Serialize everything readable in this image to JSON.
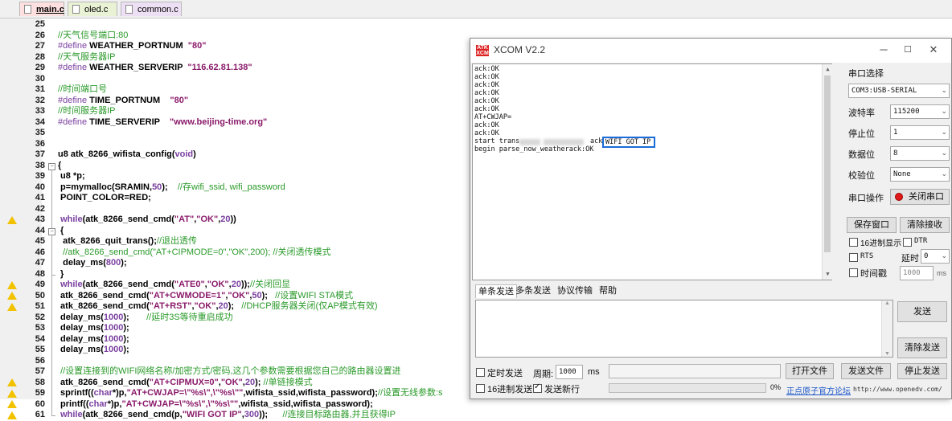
{
  "editor": {
    "tabs": [
      "main.c",
      "oled.c",
      "common.c"
    ],
    "lines": [
      {
        "n": "25",
        "html": ""
      },
      {
        "n": "26",
        "html": "<span class=\"cm\">//天气信号端口:80</span>"
      },
      {
        "n": "27",
        "html": "<span class=\"pp\">#define</span> WEATHER_PORTNUM  <span class=\"str\">\"80\"</span>"
      },
      {
        "n": "28",
        "html": "<span class=\"cm\">//天气服务器IP</span>"
      },
      {
        "n": "29",
        "html": "<span class=\"pp\">#define</span> WEATHER_SERVERIP  <span class=\"str\">\"116.62.81.138\"</span>"
      },
      {
        "n": "30",
        "html": ""
      },
      {
        "n": "31",
        "html": "<span class=\"cm\">//时间端口号</span>"
      },
      {
        "n": "32",
        "html": "<span class=\"pp\">#define</span> TIME_PORTNUM    <span class=\"str\">\"80\"</span>"
      },
      {
        "n": "33",
        "html": "<span class=\"cm\">//时间服务器IP</span>"
      },
      {
        "n": "34",
        "html": "<span class=\"pp\">#define</span> TIME_SERVERIP    <span class=\"str\">\"www.beijing-time.org\"</span>"
      },
      {
        "n": "35",
        "html": ""
      },
      {
        "n": "36",
        "html": ""
      },
      {
        "n": "37",
        "html": "u8 atk_8266_wifista_config(<span class=\"kw\">void</span>)"
      },
      {
        "n": "38",
        "html": "{"
      },
      {
        "n": "39",
        "html": " u8 *p;"
      },
      {
        "n": "40",
        "html": " p=mymalloc(SRAMIN,<span class=\"num\">50</span>);    <span class=\"cm\">//存wifi_ssid, wifi_password</span>"
      },
      {
        "n": "41",
        "html": " POINT_COLOR=RED;"
      },
      {
        "n": "42",
        "html": ""
      },
      {
        "n": "43",
        "html": " <span class=\"kw\">while</span>(atk_8266_send_cmd(<span class=\"str\">\"AT\"</span>,<span class=\"str\">\"OK\"</span>,<span class=\"num\">20</span>))"
      },
      {
        "n": "44",
        "html": " {"
      },
      {
        "n": "45",
        "html": "  atk_8266_quit_trans();<span class=\"cm\">//退出透传</span>"
      },
      {
        "n": "46",
        "html": "  <span class=\"cm\">//atk_8266_send_cmd(\"AT+CIPMODE=0\",\"OK\",200); //关闭透传模式</span>"
      },
      {
        "n": "47",
        "html": "  delay_ms(<span class=\"num\">800</span>);"
      },
      {
        "n": "48",
        "html": " }"
      },
      {
        "n": "49",
        "html": " <span class=\"kw\">while</span>(atk_8266_send_cmd(<span class=\"str\">\"ATE0\"</span>,<span class=\"str\">\"OK\"</span>,<span class=\"num\">20</span>));<span class=\"cm\">//关闭回显</span>"
      },
      {
        "n": "50",
        "html": " atk_8266_send_cmd(<span class=\"str\">\"AT+CWMODE=1\"</span>,<span class=\"str\">\"OK\"</span>,<span class=\"num\">50</span>);   <span class=\"cm\">//设置WIFI STA模式</span>"
      },
      {
        "n": "51",
        "html": " atk_8266_send_cmd(<span class=\"str\">\"AT+RST\"</span>,<span class=\"str\">\"OK\"</span>,<span class=\"num\">20</span>);   <span class=\"cm\">//DHCP服务器关闭(仅AP模式有效)</span>"
      },
      {
        "n": "52",
        "html": " delay_ms(<span class=\"num\">1000</span>);       <span class=\"cm\">//延时3S等待重启成功</span>"
      },
      {
        "n": "53",
        "html": " delay_ms(<span class=\"num\">1000</span>);"
      },
      {
        "n": "54",
        "html": " delay_ms(<span class=\"num\">1000</span>);"
      },
      {
        "n": "55",
        "html": " delay_ms(<span class=\"num\">1000</span>);"
      },
      {
        "n": "56",
        "html": ""
      },
      {
        "n": "57",
        "html": " <span class=\"cm\">//设置连接到的WIFI网络名称/加密方式/密码,这几个参数需要根据您自己的路由器设置进</span>"
      },
      {
        "n": "58",
        "html": " atk_8266_send_cmd(<span class=\"str\">\"AT+CIPMUX=0\"</span>,<span class=\"str\">\"OK\"</span>,<span class=\"num\">20</span>); <span class=\"cm\">//单链接模式</span>"
      },
      {
        "n": "59",
        "html": " sprintf((<span class=\"kw\">char</span>*)p,<span class=\"str\">\"AT+CWJAP=\\\"%s\\\",\\\"%s\\\"\"</span>,wifista_ssid,wifista_password);<span class=\"cm\">//设置无线参数:s</span>"
      },
      {
        "n": "60",
        "html": " printf((<span class=\"kw\">char</span>*)p,<span class=\"str\">\"AT+CWJAP=\\\"%s\\\",\\\"%s\\\"\"</span>,wifista_ssid,wifista_password);"
      },
      {
        "n": "61",
        "html": " <span class=\"kw\">while</span>(atk_8266_send_cmd(p,<span class=\"str\">\"WIFI GOT IP\"</span>,<span class=\"num\">300</span>));      <span class=\"cm\">//连接目标路由器,并且获得IP</span>"
      }
    ],
    "warning_lines": [
      "43",
      "49",
      "50",
      "51",
      "58",
      "59",
      "60",
      "61"
    ]
  },
  "xcom": {
    "title": "XCOM V2.2",
    "logo": "ATK XCOM",
    "window_buttons": [
      "─",
      "☐",
      "✕"
    ],
    "receive_lines": [
      "ack:OK",
      "ack:OK",
      "ack:OK",
      "ack:OK",
      "ack:OK",
      "ack:OK",
      "AT+CWJAP=",
      "ack:OK",
      "ack:OK",
      "start trans...",
      "begin parse_now_weatherack:OK"
    ],
    "cwjap_suffix": "ack",
    "wifi_got_ip": "WIFI GOT IP",
    "port_select_label": "串口选择",
    "port_value": "COM3:USB-SERIAL",
    "baud_label": "波特率",
    "baud_value": "115200",
    "stop_label": "停止位",
    "stop_value": "1",
    "data_label": "数据位",
    "data_value": "8",
    "parity_label": "校验位",
    "parity_value": "None",
    "port_op_label": "串口操作",
    "close_port_button": "关闭串口",
    "save_window_button": "保存窗口",
    "clear_recv_button": "清除接收",
    "hex_display_label": "16进制显示",
    "dtr_label": "DTR",
    "rts_label": "RTS",
    "delay_label": "延时",
    "delay_value": "0",
    "timestamp_label": "时间戳",
    "timestamp_value": "1000",
    "ms_label": "ms",
    "send_tabs": [
      "单条发送",
      "多条发送",
      "协议传输",
      "帮助"
    ],
    "send_button": "发送",
    "clear_send_button": "清除发送",
    "timed_send_label": "定时发送",
    "period_label": "周期:",
    "period_value": "1000",
    "period_unit": "ms",
    "open_file_button": "打开文件",
    "send_file_button": "发送文件",
    "stop_send_button": "停止发送",
    "hex_send_label": "16进制发送",
    "send_newline_label": "发送新行",
    "progress_text": "0%",
    "progress_fraction": 0,
    "forum_link": "正点原子官方论坛",
    "url_text": "http://www.openedv.com/"
  }
}
